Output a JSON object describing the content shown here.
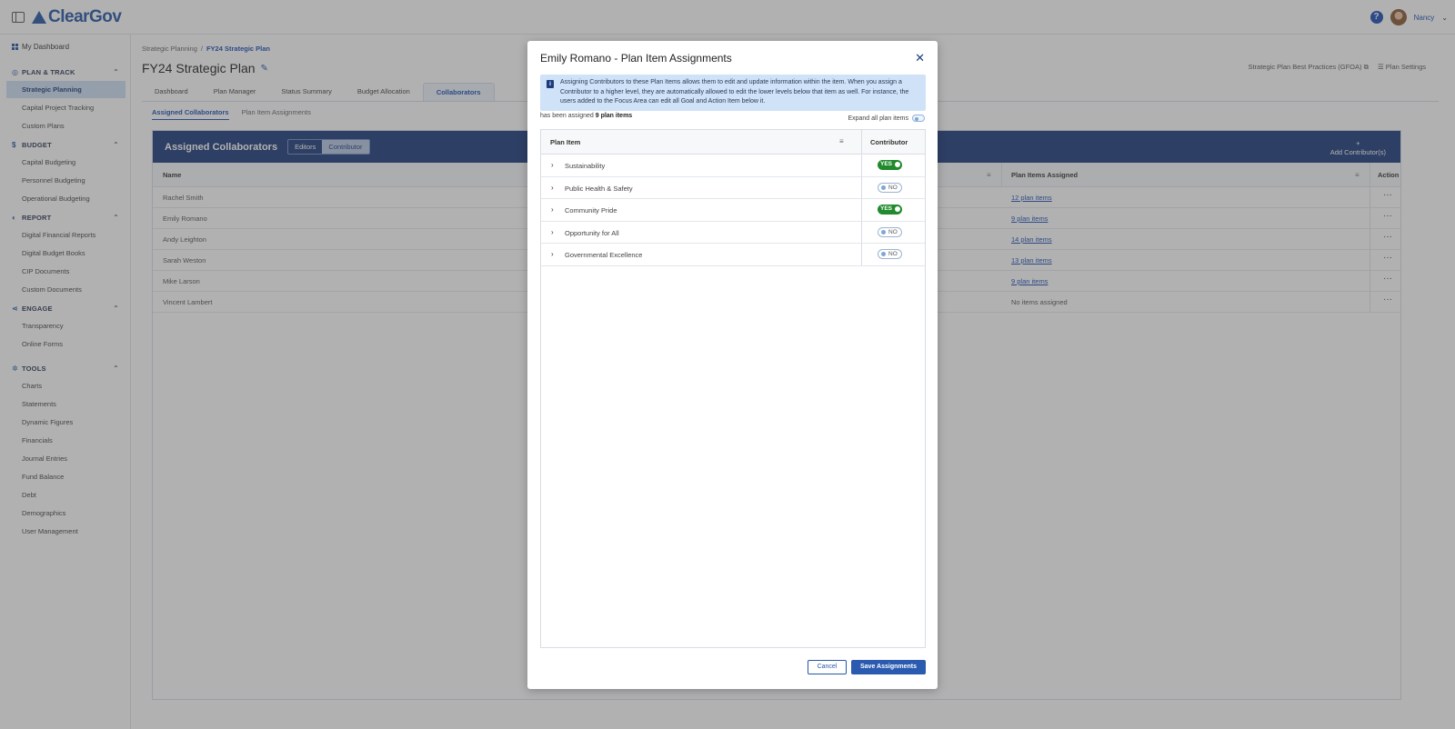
{
  "app": {
    "name": "ClearGov",
    "user_name": "Nancy",
    "help_label": "?"
  },
  "sidebar": {
    "dashboard": "My Dashboard",
    "sections": [
      {
        "title": "PLAN & TRACK",
        "icon": "compass-icon",
        "items": [
          "Strategic Planning",
          "Capital Project Tracking",
          "Custom Plans"
        ]
      },
      {
        "title": "BUDGET",
        "icon": "dollar-icon",
        "items": [
          "Capital Budgeting",
          "Personnel Budgeting",
          "Operational Budgeting"
        ]
      },
      {
        "title": "REPORT",
        "icon": "report-icon",
        "items": [
          "Digital Financial Reports",
          "Digital Budget Books",
          "CIP Documents",
          "Custom Documents"
        ]
      },
      {
        "title": "ENGAGE",
        "icon": "share-icon",
        "items": [
          "Transparency",
          "Online Forms"
        ]
      },
      {
        "title": "TOOLS",
        "icon": "gear-icon",
        "items": [
          "Charts",
          "Statements",
          "Dynamic Figures",
          "Financials",
          "Journal Entries",
          "Fund Balance",
          "Debt",
          "Demographics",
          "User Management"
        ]
      }
    ],
    "active_item": "Strategic Planning"
  },
  "breadcrumb": {
    "parent": "Strategic Planning",
    "current": "FY24 Strategic Plan"
  },
  "page": {
    "title": "FY24 Strategic Plan",
    "links": {
      "best_practices": "Strategic Plan Best Practices (GFOA)",
      "settings": "Plan Settings"
    },
    "tabs": [
      "Dashboard",
      "Plan Manager",
      "Status Summary",
      "Budget Allocation",
      "Collaborators"
    ],
    "active_tab": "Collaborators",
    "subtabs": [
      "Assigned Collaborators",
      "Plan Item Assignments"
    ]
  },
  "collaborators": {
    "title": "Assigned Collaborators",
    "segments": [
      "Editors",
      "Contributor"
    ],
    "active_segment": "Contributor",
    "add_plus": "+",
    "add_label": "Add Contributor(s)",
    "columns": {
      "name": "Name",
      "assigned": "Plan Items Assigned",
      "action": "Action"
    },
    "rows": [
      {
        "name": "Rachel Smith",
        "assigned": "12 plan items"
      },
      {
        "name": "Emily Romano",
        "assigned": "9 plan items"
      },
      {
        "name": "Andy Leighton",
        "assigned": "14 plan items"
      },
      {
        "name": "Sarah Weston",
        "assigned": "13 plan items"
      },
      {
        "name": "Mike Larson",
        "assigned": "9 plan items"
      },
      {
        "name": "Vincent Lambert",
        "assigned": "No items assigned"
      }
    ]
  },
  "modal": {
    "title": "Emily Romano - Plan Item Assignments",
    "info_icon": "i",
    "info_text": "Assigning Contributors to these Plan Items allows them to edit and update information within the item. When you assign a Contributor to a higher level, they are automatically allowed to edit the lower levels below that item as well. For instance, the users added to the Focus Area can edit all Goal and Action Item below it.",
    "assigned_prefix": "has been assigned",
    "assigned_count": "9 plan items",
    "expand_label": "Expand all plan items",
    "columns": {
      "item": "Plan Item",
      "contributor": "Contributor"
    },
    "rows": [
      {
        "label": "Sustainability",
        "value": "YES"
      },
      {
        "label": "Public Health & Safety",
        "value": "NO"
      },
      {
        "label": "Community Pride",
        "value": "YES"
      },
      {
        "label": "Opportunity for All",
        "value": "NO"
      },
      {
        "label": "Governmental Excellence",
        "value": "NO"
      }
    ],
    "cancel_label": "Cancel",
    "save_label": "Save Assignments"
  },
  "colors": {
    "brand": "#2557a7",
    "header": "#1e3c7c",
    "yes": "#208a2c",
    "info_bg": "#cfe2f7"
  }
}
